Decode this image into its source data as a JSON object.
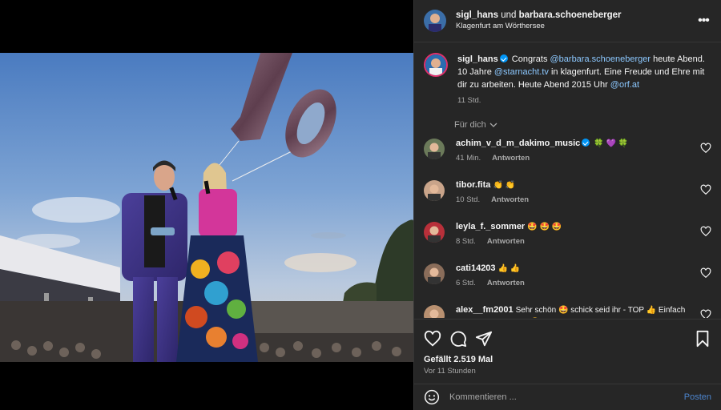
{
  "header": {
    "user1": "sigl_hans",
    "and_word": " und ",
    "user2": "barbara.schoeneberger",
    "location": "Klagenfurt am Wörthersee"
  },
  "caption": {
    "username": "sigl_hans",
    "text1": " Congrats ",
    "mention1": "@barbara.schoeneberger",
    "text2": " heute Abend. 10 Jahre ",
    "mention2": "@starnacht.tv",
    "text3": " in klagenfurt. Eine Freude und Ehre mit dir zu arbeiten. Heute Abend 2015 Uhr ",
    "mention3": "@orf.at",
    "time": "11 Std."
  },
  "filter_label": "Für dich",
  "comments": [
    {
      "username": "achim_v_d_m_dakimo_music",
      "verified": true,
      "text": "🍀 💜 🍀",
      "time": "41 Min.",
      "reply": "Antworten",
      "avatar_color": "#6b7a5a"
    },
    {
      "username": "tibor.fita",
      "verified": false,
      "text": "👏 👏",
      "time": "10 Std.",
      "reply": "Antworten",
      "avatar_color": "#c9a48a"
    },
    {
      "username": "leyla_f._sommer",
      "verified": false,
      "text": "🤩 🤩 🤩",
      "time": "8 Std.",
      "reply": "Antworten",
      "avatar_color": "#b8303a"
    },
    {
      "username": "cati14203",
      "verified": false,
      "text": "👍 👍",
      "time": "6 Std.",
      "reply": "Antworten",
      "avatar_color": "#8a6d5a"
    },
    {
      "username": "alex__fm2001",
      "verified": false,
      "text": "Sehr schön 🤩 schick seid ihr - TOP 👍 Einfach zwei tolle Menschen 🤩",
      "time": "",
      "reply": "",
      "avatar_color": "#b89070"
    }
  ],
  "likes": "Gefällt 2.519 Mal",
  "posted": "Vor 11 Stunden",
  "composer": {
    "placeholder": "Kommentieren ...",
    "post_label": "Posten"
  },
  "colors": {
    "panel_bg": "#262626",
    "link": "#8cc8ff",
    "verified": "#0095f6",
    "muted": "#a8a8a8"
  },
  "icons": [
    "more-icon",
    "heart-icon",
    "comment-icon",
    "share-icon",
    "bookmark-icon",
    "emoji-icon",
    "chevron-down-icon",
    "verified-icon"
  ]
}
